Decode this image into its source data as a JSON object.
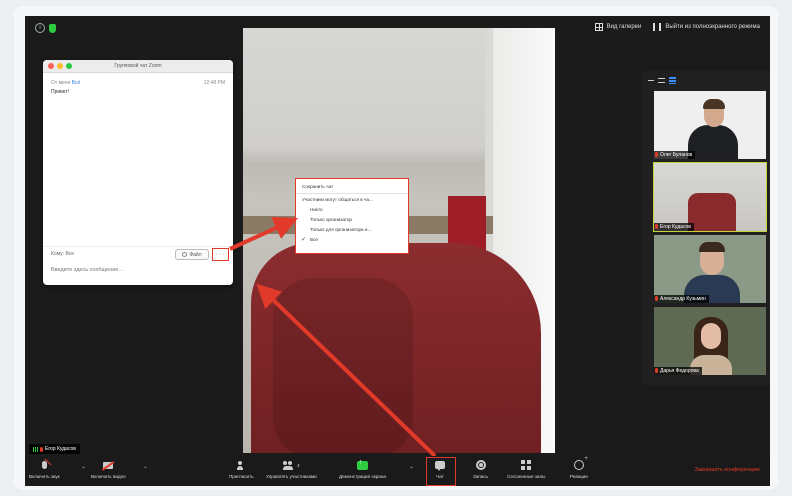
{
  "topbar": {
    "gallery_label": "Вид галереи",
    "exit_fullscreen_label": "Выйти из полноэкранного режима"
  },
  "chat": {
    "window_title": "Групповой чат Zoom",
    "from_label": "От меня",
    "from_target": "Всё",
    "time": "12:48 PM",
    "message": "Привет!",
    "to_label": "Кому: Все",
    "file_label": "Файл",
    "more_label": "···",
    "input_placeholder": "Введите здесь сообщение…"
  },
  "chat_menu": {
    "save": "Сохранить чат",
    "permission_header": "Участники могут общаться в ча...",
    "options": [
      "Никто",
      "Только организатор",
      "Только для организатора и…",
      "Все"
    ],
    "selected": "Все"
  },
  "participants": [
    {
      "name": "Олег Буланов"
    },
    {
      "name": "Егор Кудасов"
    },
    {
      "name": "Александр Кузьмин"
    },
    {
      "name": "Дарья Федорова"
    }
  ],
  "self_label": "Егор Кудасов",
  "toolbar": {
    "unmute": "Включить звук",
    "start_video": "Включить видео",
    "invite": "Пригласить",
    "manage_participants": "Управлять участниками",
    "participants_count": "4",
    "share_screen": "Демонстрация экрана",
    "chat": "Чат",
    "record": "Запись",
    "breakout_rooms": "Сессионные залы",
    "reactions": "Реакции",
    "end_meeting": "Завершить конференцию"
  },
  "colors": {
    "highlight": "#e23a2a",
    "share_green": "#2ecc40",
    "active_speaker": "#c8d23c"
  }
}
